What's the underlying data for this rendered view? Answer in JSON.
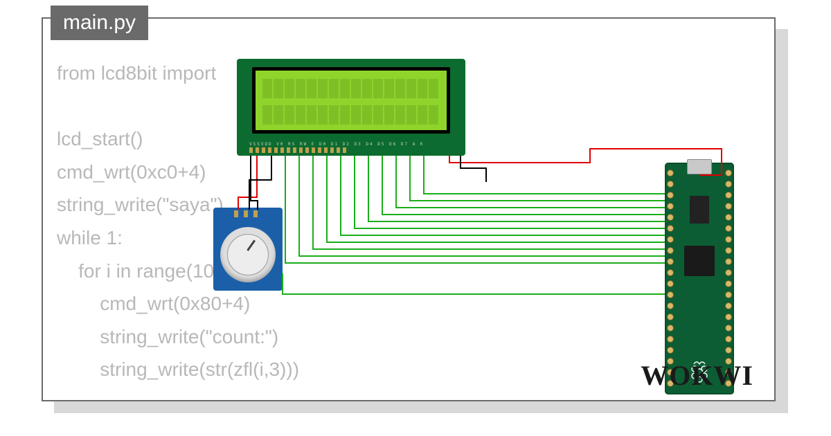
{
  "tab_label": "main.py",
  "code_lines": [
    "from lcd8bit import",
    "",
    "lcd_start()",
    "cmd_wrt(0xc0+4)",
    "string_write(\"saya\")",
    "while 1:",
    "    for i in range(10",
    "        cmd_wrt(0x80+4)",
    "        string_write(\"count:\")",
    "        string_write(str(zfl(i,3)))"
  ],
  "lcd_pin_labels": "VSSVDD V0 RS RW E D0 D1 D2 D3 D4 D5 D6 D7 A  K",
  "logo_text": "WOKWI",
  "components": {
    "lcd": "LCD 16x2 1602",
    "pot": "Potentiometer module",
    "mcu": "Raspberry Pi Pico"
  },
  "colors": {
    "tab_bg": "#6a6a6a",
    "code_fg": "#b8b8b8",
    "lcd_pcb": "#0c6b2e",
    "lcd_screen": "#8fd42a",
    "pot_pcb": "#1b5fa8",
    "pico_pcb": "#0c5d33",
    "wire_power": "#e00000",
    "wire_gnd": "#000000",
    "wire_signal": "#1aad1a"
  }
}
